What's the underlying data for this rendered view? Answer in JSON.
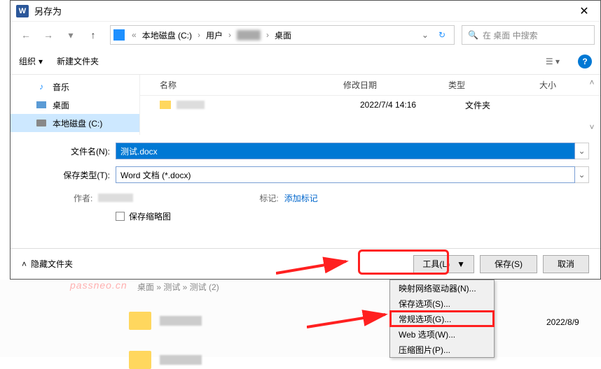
{
  "titlebar": {
    "title": "另存为"
  },
  "nav": {
    "crumbs": [
      "本地磁盘 (C:)",
      "用户",
      "",
      "桌面"
    ],
    "search_placeholder": "在 桌面 中搜索"
  },
  "toolbar": {
    "organize": "组织",
    "newfolder": "新建文件夹"
  },
  "sidebar": {
    "items": [
      {
        "label": "音乐"
      },
      {
        "label": "桌面"
      },
      {
        "label": "本地磁盘 (C:)"
      }
    ]
  },
  "filelist": {
    "headers": {
      "name": "名称",
      "date": "修改日期",
      "type": "类型",
      "size": "大小"
    },
    "rows": [
      {
        "date": "2022/7/4 14:16",
        "type": "文件夹"
      }
    ]
  },
  "form": {
    "filename_label": "文件名(N):",
    "filename_value": "测试.docx",
    "filetype_label": "保存类型(T):",
    "filetype_value": "Word 文档 (*.docx)",
    "author_label": "作者:",
    "tag_label": "标记:",
    "tag_link": "添加标记",
    "thumbnail_label": "保存缩略图"
  },
  "footer": {
    "hide_folders": "隐藏文件夹",
    "tools": "工具(L)",
    "save": "保存(S)",
    "cancel": "取消"
  },
  "menu": {
    "items": [
      "映射网络驱动器(N)...",
      "保存选项(S)...",
      "常规选项(G)...",
      "Web 选项(W)...",
      "压缩图片(P)..."
    ]
  },
  "background": {
    "watermark": "passneo.cn",
    "crumb": "桌面 » 测试 » 测试 (2)",
    "date": "2022/8/9"
  }
}
